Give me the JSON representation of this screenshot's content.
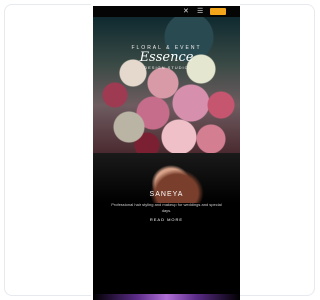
{
  "topbar": {
    "icons": [
      "close-icon",
      "menu-icon"
    ]
  },
  "hero": {
    "kicker": "FLORAL & EVENT",
    "brand_name": "Essence",
    "subtitle": "DESIGN STUDIO"
  },
  "section": {
    "title": "SANEYA",
    "text": "Professional hair styling and makeup for weddings and special days.",
    "link": "READ MORE"
  },
  "colors": {
    "accent": "#f2a51a",
    "background": "#000000"
  }
}
